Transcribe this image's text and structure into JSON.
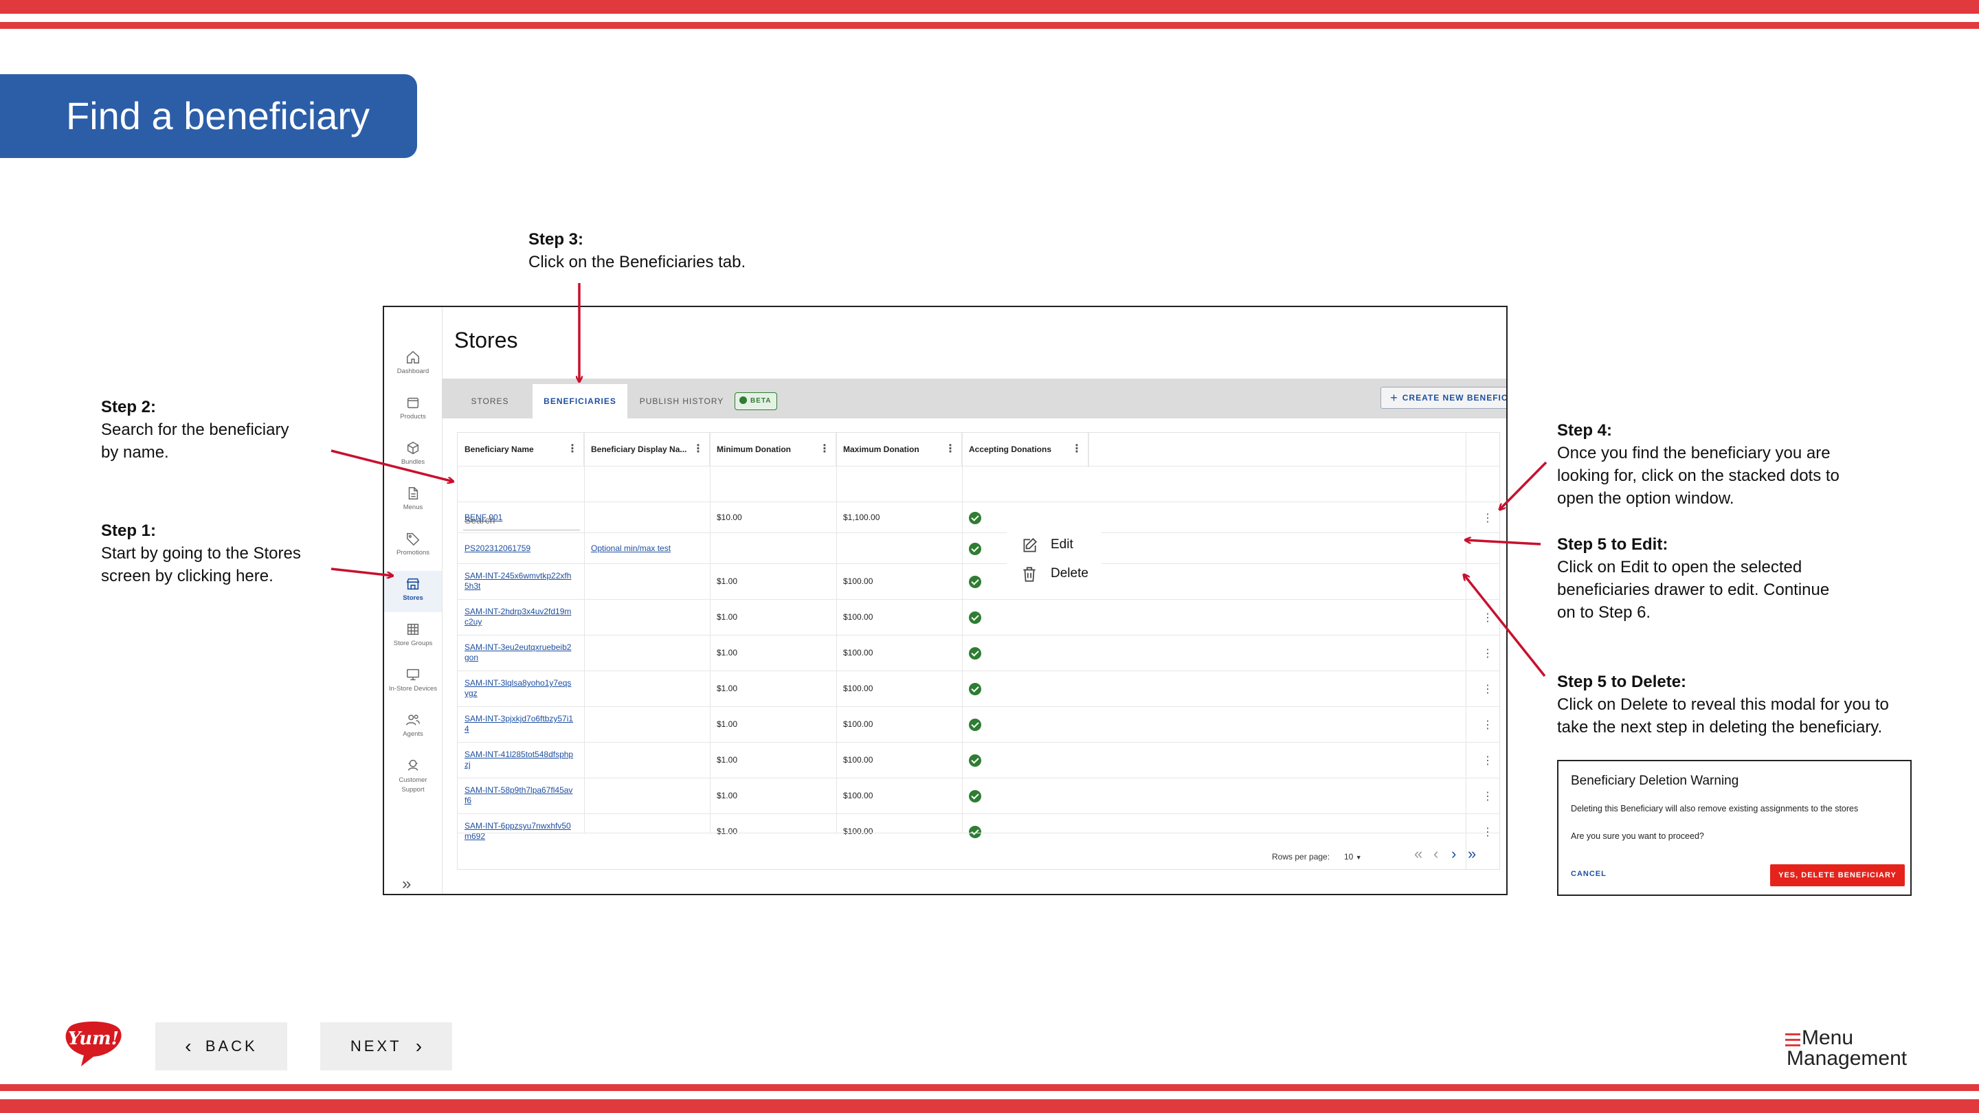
{
  "banner": {
    "title": "Find a beneficiary"
  },
  "steps": {
    "step3": {
      "title": "Step 3:",
      "lines": [
        "Click on the Beneficiaries tab."
      ]
    },
    "step2": {
      "title": "Step 2:",
      "lines": [
        "Search for the beneficiary",
        "by name."
      ]
    },
    "step1": {
      "title": "Step 1:",
      "lines": [
        "Start by going to the Stores",
        "screen by clicking here."
      ]
    },
    "step4": {
      "title": "Step 4:",
      "lines": [
        "Once you find the beneficiary you are",
        "looking for, click on the stacked dots to",
        "open the option window."
      ]
    },
    "step5_edit": {
      "title": "Step 5 to Edit:",
      "lines": [
        "Click on Edit to open the selected",
        "beneficiaries drawer to edit. Continue",
        "on to Step 6."
      ]
    },
    "step5_delete": {
      "title": "Step 5 to Delete:",
      "lines": [
        "Click on Delete to reveal this modal for you to",
        "take the next step in deleting the beneficiary."
      ]
    }
  },
  "app": {
    "title": "Stores",
    "sidebar": [
      {
        "label": "Dashboard",
        "icon": "home-icon"
      },
      {
        "label": "Products",
        "icon": "box-icon"
      },
      {
        "label": "Bundles",
        "icon": "cube-icon"
      },
      {
        "label": "Menus",
        "icon": "document-icon"
      },
      {
        "label": "Promotions",
        "icon": "tag-icon"
      },
      {
        "label": "Stores",
        "icon": "store-icon",
        "active": true
      },
      {
        "label": "Store Groups",
        "icon": "grid-icon"
      },
      {
        "label": "In-Store Devices",
        "icon": "monitor-icon"
      },
      {
        "label": "Agents",
        "icon": "users-icon"
      },
      {
        "label": "Customer Support",
        "icon": "support-icon"
      }
    ],
    "tabs": [
      {
        "label": "STORES"
      },
      {
        "label": "BENEFICIARIES",
        "active": true
      },
      {
        "label": "PUBLISH HISTORY"
      }
    ],
    "beta_badge": "BETA",
    "create_button": "CREATE NEW BENEFICIARY",
    "columns": [
      "Beneficiary Name",
      "Beneficiary Display Na...",
      "Minimum Donation",
      "Maximum Donation",
      "Accepting Donations"
    ],
    "search_placeholder": "Search",
    "rows": [
      {
        "name": "BENF 001",
        "display": "",
        "min": "$10.00",
        "max": "$1,100.00",
        "accepting": true
      },
      {
        "name": "PS202312061759",
        "display": "Optional min/max test",
        "min": "",
        "max": "",
        "accepting": true
      },
      {
        "name": "SAM-INT-245x6wmvtkp22xfh5h3t",
        "display": "",
        "min": "$1.00",
        "max": "$100.00",
        "accepting": true
      },
      {
        "name": "SAM-INT-2hdrp3x4uv2fd19mc2uy",
        "display": "",
        "min": "$1.00",
        "max": "$100.00",
        "accepting": true
      },
      {
        "name": "SAM-INT-3eu2eutqxruebeib2gon",
        "display": "",
        "min": "$1.00",
        "max": "$100.00",
        "accepting": true
      },
      {
        "name": "SAM-INT-3lqlsa8yoho1y7eqsygz",
        "display": "",
        "min": "$1.00",
        "max": "$100.00",
        "accepting": true
      },
      {
        "name": "SAM-INT-3pjxkjd7o6ftbzy57i14",
        "display": "",
        "min": "$1.00",
        "max": "$100.00",
        "accepting": true
      },
      {
        "name": "SAM-INT-41l285tot548dfsphpzj",
        "display": "",
        "min": "$1.00",
        "max": "$100.00",
        "accepting": true
      },
      {
        "name": "SAM-INT-58p9th7lpa67fl45avf6",
        "display": "",
        "min": "$1.00",
        "max": "$100.00",
        "accepting": true
      },
      {
        "name": "SAM-INT-6ppzsyu7nwxhfv50m692",
        "display": "",
        "min": "$1.00",
        "max": "$100.00",
        "accepting": true
      }
    ],
    "row_menu": {
      "edit": "Edit",
      "delete": "Delete"
    },
    "footer": {
      "rows_per_page_label": "Rows per page:",
      "rows_per_page_value": "10"
    }
  },
  "modal": {
    "title": "Beneficiary Deletion Warning",
    "text1": "Deleting this Beneficiary will also remove existing assignments to the stores",
    "text2": "Are you sure you want to proceed?",
    "cancel": "CANCEL",
    "confirm": "YES, DELETE BENEFICIARY"
  },
  "nav": {
    "back": "BACK",
    "next": "NEXT"
  },
  "brand": {
    "logo_text": "Yum!",
    "product_line1": "Menu",
    "product_line2": "Management"
  },
  "colors": {
    "accent_red": "#e03a3e",
    "banner_blue": "#2c5ea8",
    "link_blue": "#1d4fa0",
    "success_green": "#2e7d32",
    "danger_red": "#e5231b"
  }
}
